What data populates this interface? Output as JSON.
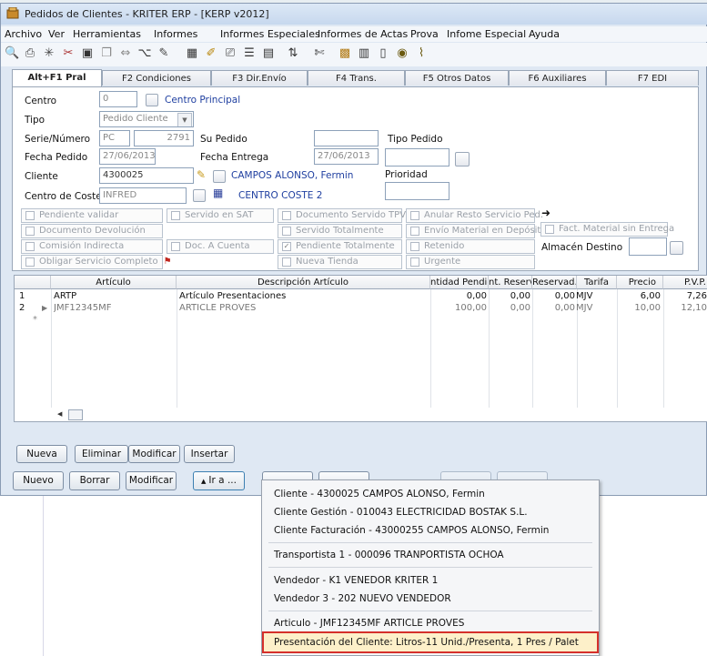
{
  "window": {
    "title": "Pedidos de Clientes - KRITER ERP - [KERP v2012]"
  },
  "menu": [
    "Archivo",
    "Ver",
    "Herramientas",
    "Informes",
    "Informes Especiales",
    "Informes de Actas",
    "Prova",
    "Infome Especial",
    "Ayuda"
  ],
  "toolbar_icons": [
    "preview-icon",
    "print-icon",
    "asterisk-icon",
    "tools-icon",
    "save-icon",
    "copy-icon",
    "expand-icon",
    "hierarchy-icon",
    "edit-icon",
    "grid-icon",
    "pencil-icon",
    "printer-icon",
    "list-icon",
    "report-icon",
    "sort-icon",
    "cut-icon",
    "app-icon",
    "page-icon",
    "document-icon",
    "coins-icon",
    "attach-icon"
  ],
  "tabs": [
    "Alt+F1 Pral",
    "F2 Condiciones",
    "F3 Dir.Envío",
    "F4 Trans.",
    "F5 Otros Datos",
    "F6 Auxiliares",
    "F7 EDI"
  ],
  "form": {
    "centro_label": "Centro",
    "centro_value": "0",
    "centro_link": "Centro Principal",
    "tipo_label": "Tipo",
    "tipo_value": "Pedido Cliente",
    "serie_label": "Serie/Número",
    "serie_value": "PC",
    "numero_value": "2791",
    "supedido_label": "Su Pedido",
    "supedido_value": "",
    "tipopedido_label": "Tipo Pedido",
    "tipopedido_value": "",
    "fechapedido_label": "Fecha Pedido",
    "fechapedido_value": "27/06/2013",
    "fechaentrega_label": "Fecha Entrega",
    "fechaentrega_value": "27/06/2013",
    "cliente_label": "Cliente",
    "cliente_value": "4300025",
    "cliente_link": "CAMPOS ALONSO, Fermin",
    "prioridad_label": "Prioridad",
    "prioridad_value": "",
    "coste_label": "Centro de Coste",
    "coste_value": "INFRED",
    "coste_link": "CENTRO COSTE 2",
    "almacen_label": "Almacén Destino",
    "almacen_value": ""
  },
  "checkboxes": {
    "col1": [
      "Pendiente validar",
      "Documento Devolución",
      "Comisión Indirecta",
      "Obligar Servicio Completo"
    ],
    "col2": [
      "Servido en SAT",
      "Doc. A Cuenta"
    ],
    "col3": [
      "Documento Servido TPV",
      "Servido Totalmente",
      "Pendiente Totalmente",
      "Nueva Tienda"
    ],
    "col3_checked": [
      false,
      false,
      true,
      false
    ],
    "col4": [
      "Anular Resto Servicio Ped.",
      "Envío Material en Depósito",
      "Retenido",
      "Urgente"
    ],
    "fact": "Fact. Material sin Entrega"
  },
  "grid": {
    "headers": [
      "Artículo",
      "Descripción Artículo",
      "ntidad Pendie",
      "nt. Reserva",
      "Reservad.",
      "Tarifa",
      "Precio",
      "P.V.P."
    ],
    "rows": [
      {
        "n": "1",
        "articulo": "ARTP",
        "descripcion": "Artículo Presentaciones",
        "cantidad": "0,00",
        "reserva": "0,00",
        "reservad": "0,00",
        "tarifa": "MJV",
        "precio": "6,00",
        "pvp": "7,26"
      },
      {
        "n": "2",
        "articulo": "JMF12345MF",
        "descripcion": "ARTICLE PROVES",
        "cantidad": "100,00",
        "reserva": "0,00",
        "reservad": "0,00",
        "tarifa": "MJV",
        "precio": "10,00",
        "pvp": "12,10"
      }
    ],
    "new_row_marker": "*"
  },
  "grid_buttons": [
    "Nueva",
    "Eliminar",
    "Modificar",
    "Insertar"
  ],
  "bottom_buttons": [
    "Nuevo",
    "Borrar",
    "Modificar",
    "Ir a ..."
  ],
  "popup": {
    "items": [
      "Cliente - 4300025 CAMPOS ALONSO, Fermin",
      "Cliente Gestión - 010043 ELECTRICIDAD BOSTAK S.L.",
      "Cliente Facturación - 43000255 CAMPOS ALONSO, Fermin",
      "Transportista 1 - 000096 TRANPORTISTA OCHOA",
      "Vendedor - K1 VENEDOR KRITER 1",
      "Vendedor 3 - 202 NUEVO VENDEDOR",
      "Articulo - JMF12345MF ARTICLE PROVES",
      "Presentación del Cliente: Litros-11 Unid./Presenta, 1 Pres / Palet"
    ],
    "highlight_color": "#d5302b"
  }
}
